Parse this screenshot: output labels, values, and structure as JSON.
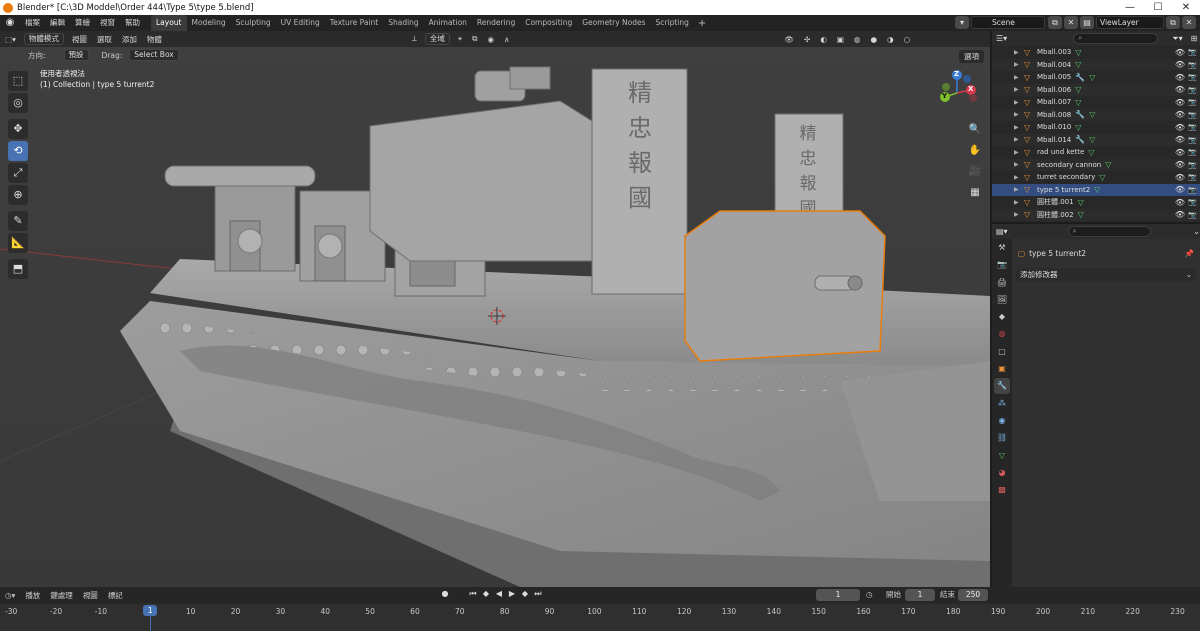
{
  "window": {
    "title": "Blender* [C:\\3D Moddel\\Order 444\\Type 5\\type 5.blend]",
    "min": "—",
    "max": "☐",
    "close": "✕"
  },
  "menu": [
    "檔案",
    "編輯",
    "算繪",
    "視窗",
    "幫助"
  ],
  "workspaces": [
    "Layout",
    "Modeling",
    "Sculpting",
    "UV Editing",
    "Texture Paint",
    "Shading",
    "Animation",
    "Rendering",
    "Compositing",
    "Geometry Nodes",
    "Scripting"
  ],
  "workspace_plus": "+",
  "scene": {
    "name": "Scene",
    "view_layer": "ViewLayer"
  },
  "viewport_header": {
    "mode": "物體模式",
    "menus": [
      "視圖",
      "選取",
      "添加",
      "物體"
    ],
    "transform_orientation": "全域",
    "options": "選項"
  },
  "viewport_sub": {
    "orientation_label": "方向:",
    "orientation_value": "預設",
    "drag_label": "Drag:",
    "drag_value": "Select Box"
  },
  "viewport_info": {
    "line1": "使用者透視法",
    "line2": "(1) Collection | type 5 turrent2"
  },
  "gizmo": {
    "x": "X",
    "y": "Y",
    "z": "Z"
  },
  "outliner": {
    "rows": [
      {
        "name": "Mball.003",
        "mod": false
      },
      {
        "name": "Mball.004",
        "mod": false
      },
      {
        "name": "Mball.005",
        "mod": true
      },
      {
        "name": "Mball.006",
        "mod": false
      },
      {
        "name": "Mball.007",
        "mod": false
      },
      {
        "name": "Mball.008",
        "mod": true
      },
      {
        "name": "Mball.010",
        "mod": false
      },
      {
        "name": "Mball.014",
        "mod": true
      },
      {
        "name": "rad und kette",
        "mod": false
      },
      {
        "name": "secondary cannon",
        "mod": false
      },
      {
        "name": "turret secondary",
        "mod": false
      },
      {
        "name": "type 5 turrent2",
        "mod": false
      },
      {
        "name": "圓柱體.001",
        "mod": false
      },
      {
        "name": "圓柱體.002",
        "mod": false
      }
    ]
  },
  "properties": {
    "object_name": "type 5 turrent2",
    "add_modifier": "添加修改器"
  },
  "timeline": {
    "menus": [
      "播放",
      "鍵處理",
      "視圖",
      "標記"
    ],
    "current_frame": "1",
    "start_label": "開始",
    "start": "1",
    "end_label": "結束",
    "end": "250",
    "ticks": [
      "-30",
      "-20",
      "-10",
      "1",
      "10",
      "20",
      "30",
      "40",
      "50",
      "60",
      "70",
      "80",
      "90",
      "100",
      "110",
      "120",
      "130",
      "140",
      "150",
      "160",
      "170",
      "180",
      "190",
      "200",
      "210",
      "220",
      "230"
    ]
  },
  "colors": {
    "accent": "#4772b3",
    "object_orange": "#e87d0d",
    "x_axis": "#d9384b",
    "y_axis": "#7cbf2a",
    "z_axis": "#3b7ed9"
  }
}
